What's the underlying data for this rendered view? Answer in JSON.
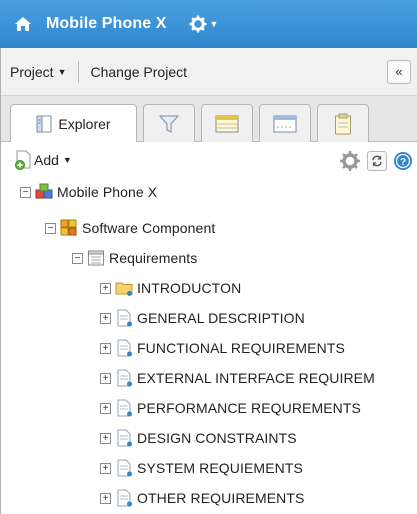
{
  "header": {
    "title": "Mobile Phone X",
    "home_icon": "home-icon",
    "gear_icon": "gear-icon"
  },
  "menubar": {
    "project_label": "Project",
    "change_project_label": "Change Project",
    "collapse_label": "«"
  },
  "tabs": [
    {
      "label": "Explorer",
      "icon": "explorer-icon",
      "active": true
    },
    {
      "label": "",
      "icon": "filter-icon"
    },
    {
      "label": "",
      "icon": "table-icon"
    },
    {
      "label": "",
      "icon": "window-icon"
    },
    {
      "label": "",
      "icon": "clipboard-icon"
    }
  ],
  "toolbar": {
    "add_label": "Add",
    "tools": [
      "settings-icon",
      "refresh-icon",
      "help-icon"
    ]
  },
  "tree": {
    "root": {
      "label": "Mobile Phone X",
      "expander": "−"
    },
    "component": {
      "label": "Software Component",
      "expander": "−"
    },
    "requirements": {
      "label": "Requirements",
      "expander": "−"
    },
    "items": [
      {
        "label": "INTRODUCTON",
        "icon": "folder-icon",
        "expander": "+"
      },
      {
        "label": "GENERAL DESCRIPTION",
        "icon": "document-icon",
        "expander": "+"
      },
      {
        "label": "FUNCTIONAL REQUIREMENTS",
        "icon": "document-icon",
        "expander": "+"
      },
      {
        "label": "EXTERNAL INTERFACE REQUIREM",
        "icon": "document-icon",
        "expander": "+"
      },
      {
        "label": "PERFORMANCE REQUREMENTS",
        "icon": "document-icon",
        "expander": "+"
      },
      {
        "label": "DESIGN CONSTRAINTS",
        "icon": "document-icon",
        "expander": "+"
      },
      {
        "label": "SYSTEM REQUIEMENTS",
        "icon": "document-icon",
        "expander": "+"
      },
      {
        "label": "OTHER REQUIREMENTS",
        "icon": "document-icon",
        "expander": "+"
      }
    ]
  },
  "colors": {
    "header_bg": "#3a93d6",
    "accent_blue": "#2f86cd"
  }
}
